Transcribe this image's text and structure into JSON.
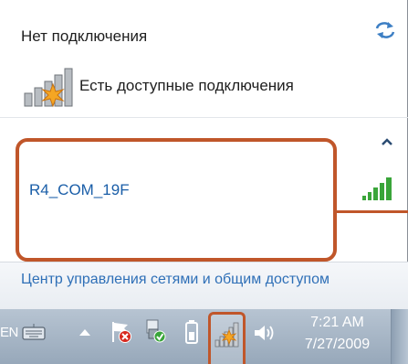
{
  "flyout": {
    "status_title": "Нет подключения",
    "available_label": "Есть доступные подключения",
    "network": {
      "ssid": "R4_COM_19F",
      "signal_strength_bars": 5
    },
    "footer_link": "Центр управления сетями и общим доступом"
  },
  "taskbar": {
    "language": "EN",
    "clock_time": "7:21 AM",
    "clock_date": "7/27/2009"
  },
  "icons": {
    "refresh": "refresh-icon",
    "network_available": "network-available-icon",
    "collapse": "chevron-up-icon",
    "signal": "signal-strength-icon",
    "keyboard": "keyboard-icon",
    "show_hidden": "triangle-up-icon",
    "action_center": "action-center-flag-icon",
    "sync": "sync-center-icon",
    "battery": "battery-icon",
    "tray_network": "network-tray-icon",
    "volume": "speaker-icon"
  },
  "colors": {
    "annotation": "#c0562a",
    "link": "#2e6fb7",
    "signal_green": "#3aa53a",
    "starburst": "#f5a623"
  }
}
